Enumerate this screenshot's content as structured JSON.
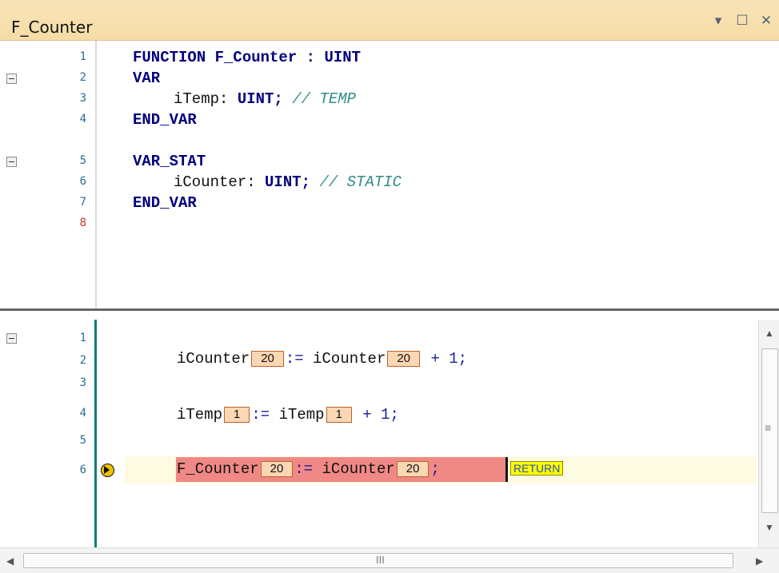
{
  "window": {
    "title": "F_Counter"
  },
  "declaration": {
    "lines": [
      {
        "no": "1",
        "text": "FUNCTION F_Counter : UINT"
      },
      {
        "no": "2",
        "text": "VAR"
      },
      {
        "no": "3",
        "var": "iTemp: ",
        "type": "UINT;",
        "comment": "// TEMP"
      },
      {
        "no": "4",
        "text": "END_VAR"
      },
      {
        "no": "5",
        "text": "VAR_STAT"
      },
      {
        "no": "6",
        "var": "iCounter: ",
        "type": "UINT;",
        "comment": "// STATIC"
      },
      {
        "no": "7",
        "text": "END_VAR"
      },
      {
        "no": "8",
        "text": ""
      }
    ]
  },
  "implementation": {
    "lines": [
      {
        "no": "1"
      },
      {
        "no": "2",
        "lhs": "iCounter",
        "lhs_val": "20",
        "assign": ":=",
        "rhs": "iCounter",
        "rhs_val": "20",
        "rest": "+ 1;"
      },
      {
        "no": "3"
      },
      {
        "no": "4",
        "lhs": "iTemp",
        "lhs_val": "1",
        "assign": ":=",
        "rhs": "iTemp",
        "rhs_val": "1",
        "rest": "+ 1;"
      },
      {
        "no": "5"
      },
      {
        "no": "6",
        "lhs": "F_Counter",
        "lhs_val": "20",
        "assign": ":=",
        "rhs": "iCounter",
        "rhs_val": "20",
        "rest": ";",
        "badge": "RETURN"
      }
    ]
  },
  "scrollbar": {
    "grip": "≡",
    "hgrip": "III"
  }
}
